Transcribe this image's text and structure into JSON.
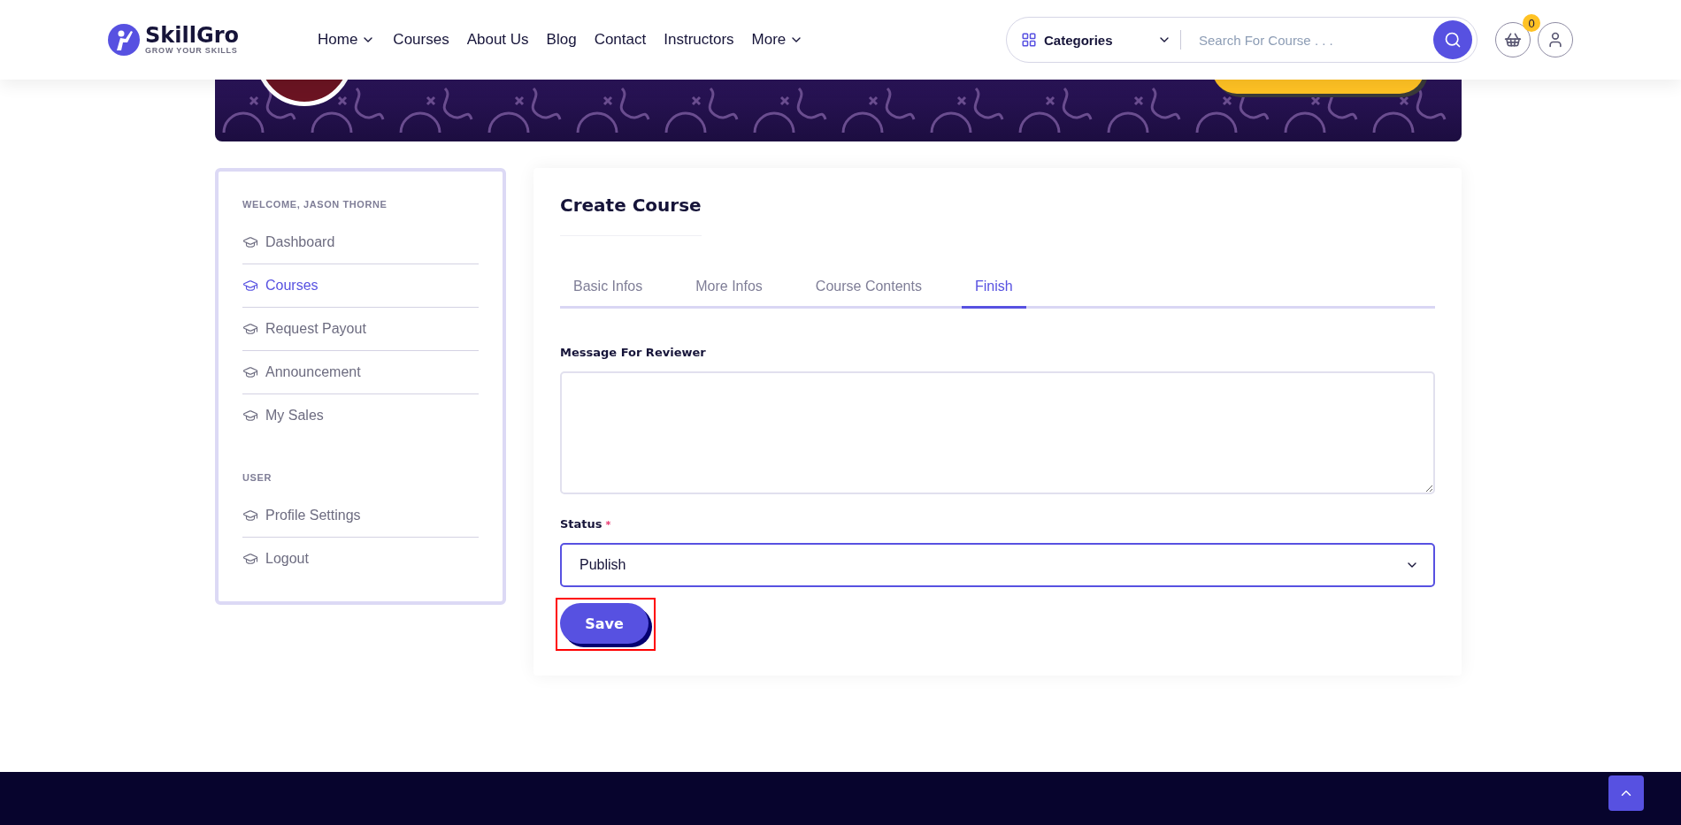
{
  "header": {
    "logo": {
      "name": "SkillGro",
      "tagline": "GROW YOUR SKILLS"
    },
    "nav": [
      {
        "label": "Home",
        "dropdown": true
      },
      {
        "label": "Courses",
        "dropdown": false
      },
      {
        "label": "About Us",
        "dropdown": false
      },
      {
        "label": "Blog",
        "dropdown": false
      },
      {
        "label": "Contact",
        "dropdown": false
      },
      {
        "label": "Instructors",
        "dropdown": false
      },
      {
        "label": "More",
        "dropdown": true
      }
    ],
    "search": {
      "category": "Categories",
      "placeholder": "Search For Course . . ."
    },
    "cart_count": "0"
  },
  "sidebar": {
    "sections": [
      {
        "heading": "WELCOME, JASON THORNE",
        "items": [
          {
            "label": "Dashboard",
            "selected": false
          },
          {
            "label": "Courses",
            "selected": true
          },
          {
            "label": "Request Payout",
            "selected": false
          },
          {
            "label": "Announcement",
            "selected": false
          },
          {
            "label": "My Sales",
            "selected": false
          }
        ]
      },
      {
        "heading": "USER",
        "items": [
          {
            "label": "Profile Settings",
            "selected": false
          },
          {
            "label": "Logout",
            "selected": false
          }
        ]
      }
    ]
  },
  "content": {
    "title": "Create Course",
    "tabs": [
      {
        "label": "Basic Infos",
        "selected": false
      },
      {
        "label": "More Infos",
        "selected": false
      },
      {
        "label": "Course Contents",
        "selected": false
      },
      {
        "label": "Finish",
        "selected": true
      }
    ],
    "message_label": "Message For Reviewer",
    "status": {
      "label": "Status",
      "required": true,
      "required_mark": "*",
      "value": "Publish"
    },
    "save_button": "Save",
    "save_highlighted": true
  }
}
